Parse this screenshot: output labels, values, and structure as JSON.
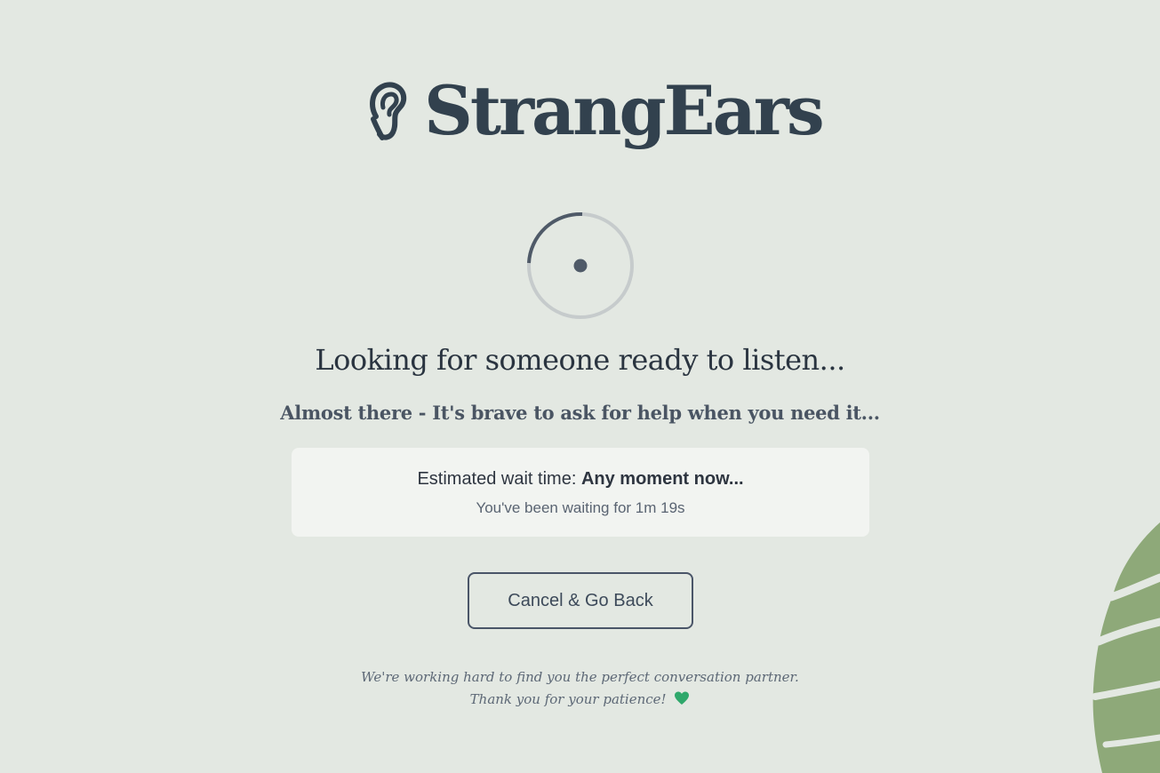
{
  "brand": {
    "name": "StrangEars",
    "icon": "ear-icon",
    "color": "#32414e"
  },
  "status": {
    "headline": "Looking for someone ready to listen...",
    "subline": "Almost there - It's brave to ask for help when you need it..."
  },
  "wait": {
    "label": "Estimated wait time:",
    "estimate": "Any moment now...",
    "elapsed": "You've been waiting for 1m 19s"
  },
  "actions": {
    "cancel_label": "Cancel & Go Back"
  },
  "footer": {
    "line1": "We're working hard to find you the perfect conversation partner.",
    "line2": "Thank you for your patience!",
    "heart_icon": "green-heart-icon"
  },
  "colors": {
    "background": "#e3e8e2",
    "card": "#f2f4f1",
    "spinner_arc": "#4f5a68",
    "leaf": "#8ea979"
  }
}
